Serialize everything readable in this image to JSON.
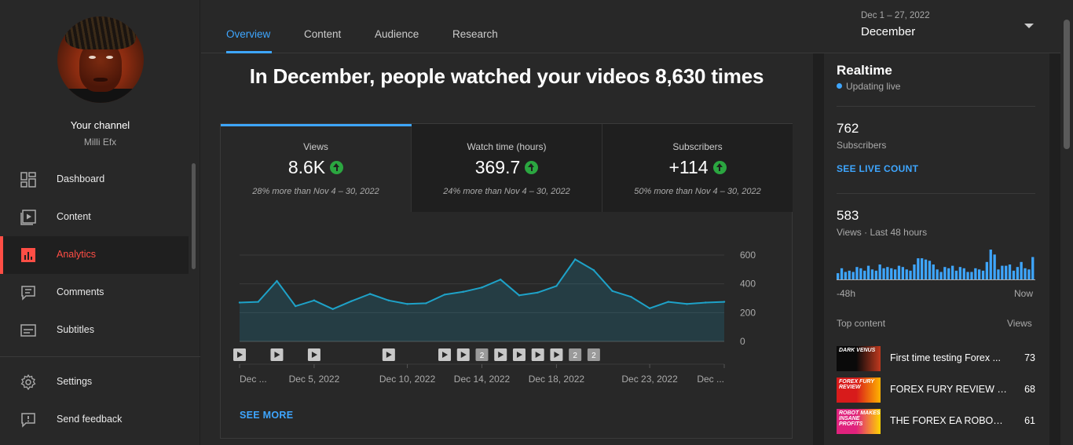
{
  "channel": {
    "title": "Your channel",
    "name": "Milli Efx"
  },
  "sidebar": {
    "items": [
      {
        "label": "Dashboard",
        "icon": "dashboard-icon"
      },
      {
        "label": "Content",
        "icon": "content-icon"
      },
      {
        "label": "Analytics",
        "icon": "analytics-icon",
        "active": true
      },
      {
        "label": "Comments",
        "icon": "comments-icon"
      },
      {
        "label": "Subtitles",
        "icon": "subtitles-icon"
      }
    ],
    "bottom_items": [
      {
        "label": "Settings",
        "icon": "gear-icon"
      },
      {
        "label": "Send feedback",
        "icon": "feedback-icon"
      }
    ]
  },
  "tabs": [
    "Overview",
    "Content",
    "Audience",
    "Research"
  ],
  "active_tab": "Overview",
  "date_picker": {
    "range": "Dec 1 – 27, 2022",
    "label": "December"
  },
  "headline": "In December, people watched your videos 8,630 times",
  "metrics": [
    {
      "title": "Views",
      "value": "8.6K",
      "compare": "28% more than Nov 4 – 30, 2022",
      "trend": "up"
    },
    {
      "title": "Watch time (hours)",
      "value": "369.7",
      "compare": "24% more than Nov 4 – 30, 2022",
      "trend": "up"
    },
    {
      "title": "Subscribers",
      "value": "+114",
      "compare": "50% more than Nov 4 – 30, 2022",
      "trend": "up"
    }
  ],
  "see_more": "SEE MORE",
  "chart_data": {
    "type": "area",
    "ylim": [
      0,
      600
    ],
    "yticks": [
      0,
      200,
      400,
      600
    ],
    "x_tick_labels": [
      "Dec ...",
      "Dec 5, 2022",
      "Dec 10, 2022",
      "Dec 14, 2022",
      "Dec 18, 2022",
      "Dec 23, 2022",
      "Dec ..."
    ],
    "x_tick_days": [
      1,
      5,
      10,
      14,
      18,
      23,
      27
    ],
    "days": [
      1,
      2,
      3,
      4,
      5,
      6,
      7,
      8,
      9,
      10,
      11,
      12,
      13,
      14,
      15,
      16,
      17,
      18,
      19,
      20,
      21,
      22,
      23,
      24,
      25,
      26,
      27
    ],
    "values": [
      270,
      275,
      420,
      245,
      285,
      225,
      280,
      330,
      285,
      260,
      265,
      325,
      345,
      375,
      430,
      320,
      340,
      385,
      570,
      495,
      350,
      310,
      230,
      275,
      260,
      270,
      275
    ],
    "color": "#1ea2c8",
    "video_markers": [
      {
        "day": 1,
        "label": ""
      },
      {
        "day": 3,
        "label": ""
      },
      {
        "day": 5,
        "label": ""
      },
      {
        "day": 9,
        "label": ""
      },
      {
        "day": 12,
        "label": ""
      },
      {
        "day": 13,
        "label": ""
      },
      {
        "day": 14,
        "label": "2"
      },
      {
        "day": 15,
        "label": ""
      },
      {
        "day": 16,
        "label": ""
      },
      {
        "day": 17,
        "label": ""
      },
      {
        "day": 18,
        "label": ""
      },
      {
        "day": 19,
        "label": "2"
      },
      {
        "day": 20,
        "label": "2"
      }
    ]
  },
  "realtime": {
    "title": "Realtime",
    "status": "Updating live",
    "subscribers_value": "762",
    "subscribers_label": "Subscribers",
    "live_count_label": "SEE LIVE COUNT",
    "views_value": "583",
    "views_label": "Views · Last 48 hours",
    "hourly_views": [
      5,
      9,
      6,
      7,
      6,
      10,
      9,
      7,
      11,
      8,
      7,
      12,
      9,
      10,
      9,
      8,
      11,
      10,
      8,
      7,
      12,
      17,
      17,
      16,
      15,
      12,
      8,
      6,
      10,
      9,
      11,
      7,
      10,
      9,
      6,
      6,
      9,
      8,
      7,
      14,
      24,
      20,
      8,
      11,
      11,
      12,
      7,
      10,
      14,
      9,
      8,
      18
    ],
    "bar_color": "#3ea6ff",
    "axis_start": "-48h",
    "axis_end": "Now",
    "top_content_title": "Top content",
    "top_content_views_header": "Views",
    "top_content": [
      {
        "title": "First time testing Forex ...",
        "views": "73",
        "thumb_text": "DARK VENUS",
        "thumb_colors": [
          "#0a0a0a",
          "#c0391e"
        ]
      },
      {
        "title": "FOREX FURY REVIEW &...",
        "views": "68",
        "thumb_text": "FOREX FURY REVIEW",
        "thumb_colors": [
          "#d81b1b",
          "#ffb300"
        ]
      },
      {
        "title": "THE FOREX EA ROBOT ...",
        "views": "61",
        "thumb_text": "ROBOT MAKES INSANE PROFITS",
        "thumb_colors": [
          "#e0227d",
          "#ffd400"
        ]
      }
    ]
  }
}
